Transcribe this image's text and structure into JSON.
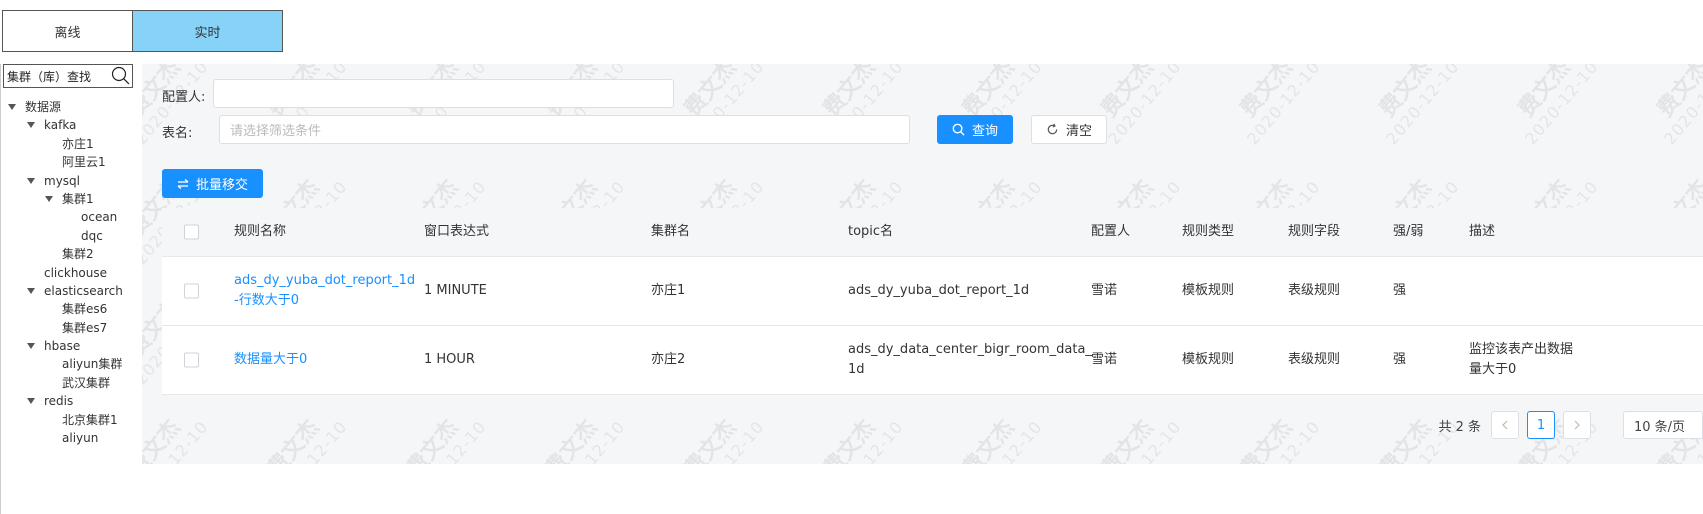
{
  "mode_tabs": [
    {
      "label": "离线",
      "active": false
    },
    {
      "label": "实时",
      "active": true
    }
  ],
  "sidebar": {
    "search_placeholder": "集群（库）查找",
    "tree": {
      "root": "数据源",
      "kafka": "kafka",
      "kafka_1": "亦庄1",
      "kafka_2": "阿里云1",
      "mysql": "mysql",
      "mysql_cluster1": "集群1",
      "mysql_ocean": "ocean",
      "mysql_dqc": "dqc",
      "mysql_cluster2": "集群2",
      "clickhouse": "clickhouse",
      "elasticsearch": "elasticsearch",
      "es_1": "集群es6",
      "es_2": "集群es7",
      "hbase": "hbase",
      "hbase_1": "aliyun集群",
      "hbase_2": "武汉集群",
      "redis": "redis",
      "redis_1": "北京集群1",
      "redis_2": "aliyun"
    }
  },
  "filters": {
    "owner_label": "配置人:",
    "owner_value": "",
    "table_label": "表名:",
    "table_placeholder": "请选择筛选条件",
    "query_label": "查询",
    "clear_label": "清空"
  },
  "batch_move_label": "批量移交",
  "table": {
    "headers": {
      "rule_name": "规则名称",
      "window": "窗口表达式",
      "cluster": "集群名",
      "topic": "topic名",
      "owner": "配置人",
      "rule_type": "规则类型",
      "rule_field": "规则字段",
      "strength": "强/弱",
      "desc": "描述"
    },
    "rows": [
      {
        "rule_name_1": "ads_dy_yuba_dot_report_1d",
        "rule_name_2": "-行数大于0",
        "window": "1 MINUTE",
        "cluster": "亦庄1",
        "topic_1": "ads_dy_yuba_dot_report_1d",
        "topic_2": "",
        "owner": "雪诺",
        "rule_type": "模板规则",
        "rule_field": "表级规则",
        "strength": "强",
        "desc_1": "",
        "desc_2": ""
      },
      {
        "rule_name_1": "数据量大于0",
        "rule_name_2": "",
        "window": "1 HOUR",
        "cluster": "亦庄2",
        "topic_1": "ads_dy_data_center_bigr_room_data_",
        "topic_2": "1d",
        "owner": "雪诺",
        "rule_type": "模板规则",
        "rule_field": "表级规则",
        "strength": "强",
        "desc_1": "监控该表产出数据",
        "desc_2": "量大于0"
      }
    ]
  },
  "pagination": {
    "total": "共 2 条",
    "current_page": "1",
    "page_size": "10 条/页"
  },
  "watermark": {
    "name": "费文杰",
    "date": "2020-12-10"
  }
}
